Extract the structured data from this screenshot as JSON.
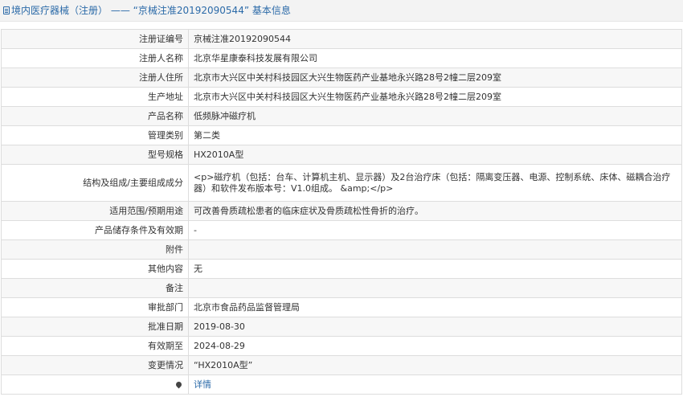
{
  "header": {
    "title": "境内医疗器械（注册） —— “京械注准20192090544” 基本信息"
  },
  "rows": [
    {
      "label": "注册证编号",
      "value": "京械注准20192090544"
    },
    {
      "label": "注册人名称",
      "value": "北京华星康泰科技发展有限公司"
    },
    {
      "label": "注册人住所",
      "value": "北京市大兴区中关村科技园区大兴生物医药产业基地永兴路28号2幢二层209室"
    },
    {
      "label": "生产地址",
      "value": "北京市大兴区中关村科技园区大兴生物医药产业基地永兴路28号2幢二层209室"
    },
    {
      "label": "产品名称",
      "value": "低频脉冲磁疗机"
    },
    {
      "label": "管理类别",
      "value": "第二类"
    },
    {
      "label": "型号规格",
      "value": "HX2010A型"
    },
    {
      "label": "结构及组成/主要组成成分",
      "value": "<p>磁疗机（包括：台车、计算机主机、显示器）及2台治疗床（包括：隔离变压器、电源、控制系统、床体、磁耦合治疗器）和软件发布版本号：V1.0组成。 &amp;</p>"
    },
    {
      "label": "适用范围/预期用途",
      "value": "可改善骨质疏松患者的临床症状及骨质疏松性骨折的治疗。"
    },
    {
      "label": "产品储存条件及有效期",
      "value": "-"
    },
    {
      "label": "附件",
      "value": ""
    },
    {
      "label": "其他内容",
      "value": "无"
    },
    {
      "label": "备注",
      "value": ""
    },
    {
      "label": "审批部门",
      "value": "北京市食品药品监督管理局"
    },
    {
      "label": "批准日期",
      "value": "2019-08-30"
    },
    {
      "label": "有效期至",
      "value": "2024-08-29"
    },
    {
      "label": "变更情况",
      "value": "“HX2010A型”"
    }
  ],
  "footer_row": {
    "icon": "location-pin-icon",
    "link_label": "详情"
  }
}
